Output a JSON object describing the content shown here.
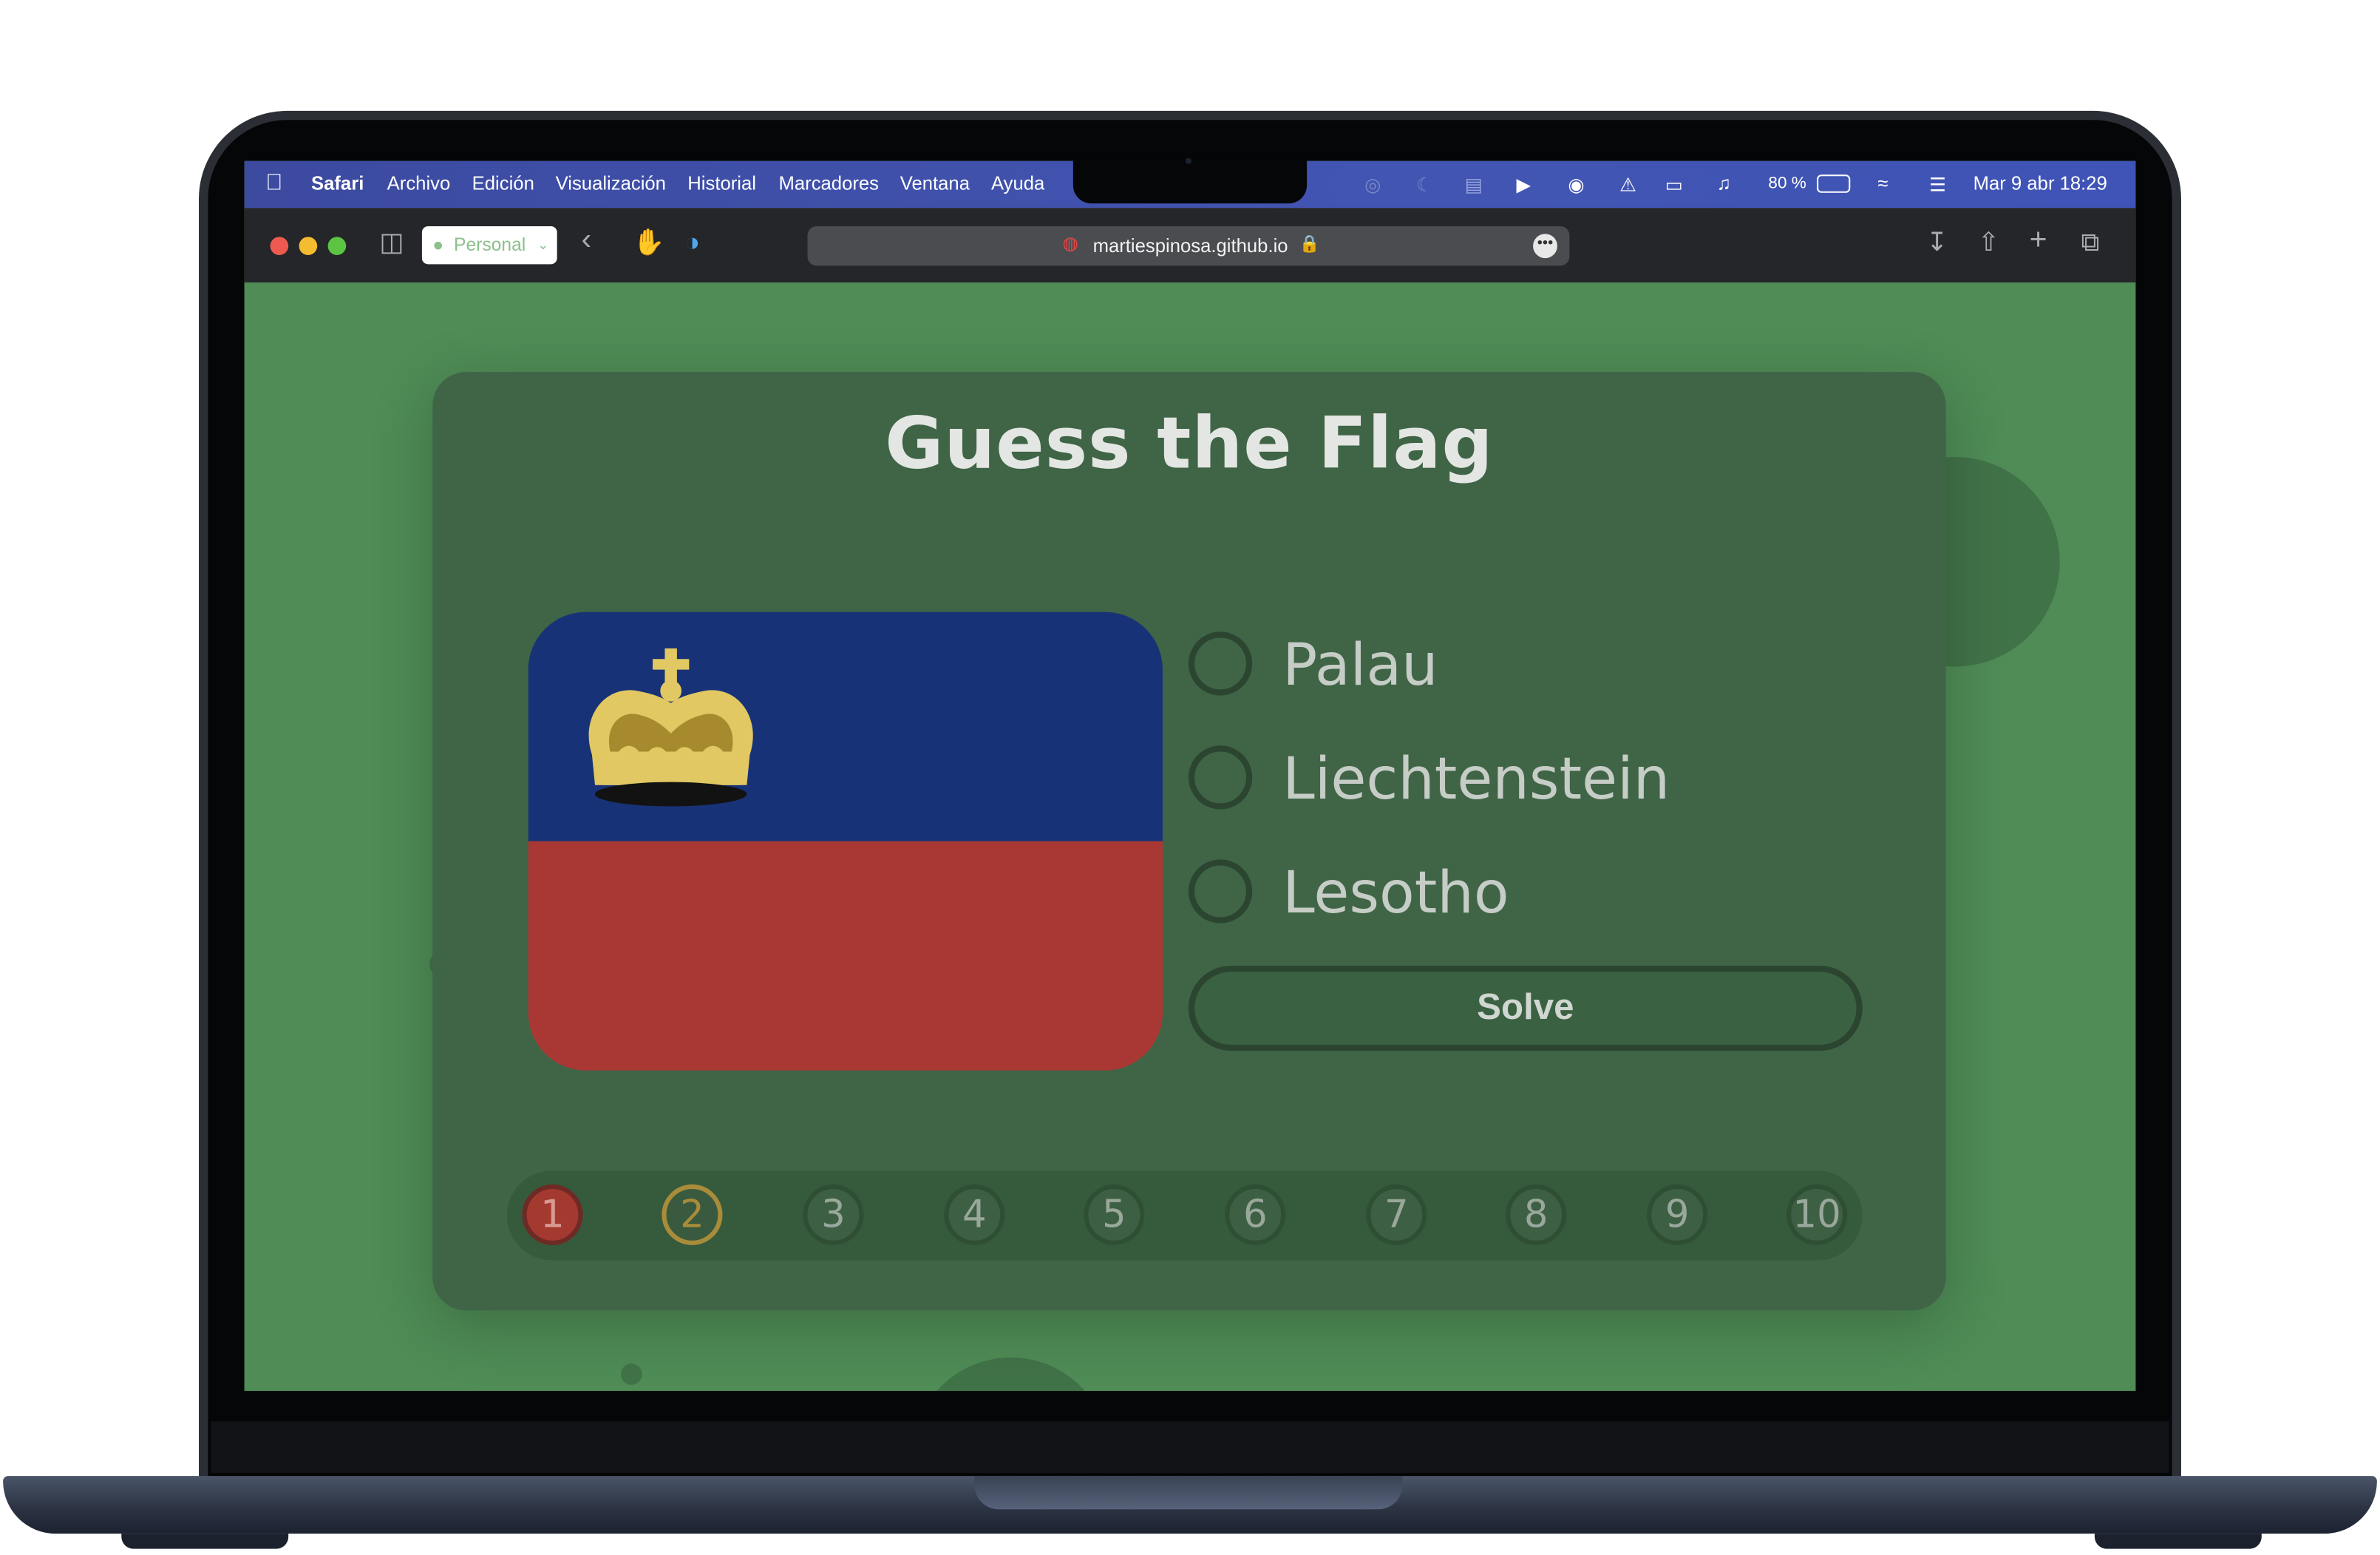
{
  "menubar": {
    "app_name": "Safari",
    "menus": [
      "Archivo",
      "Edición",
      "Visualización",
      "Historial",
      "Marcadores",
      "Ventana",
      "Ayuda"
    ],
    "battery": "80 %",
    "datetime": "Mar 9 abr 18:29"
  },
  "toolbar": {
    "profile_label": "Personal",
    "url": "martiespinosa.github.io"
  },
  "game": {
    "title": "Guess the Flag",
    "flag_country": "Liechtenstein",
    "options": [
      "Palau",
      "Liechtenstein",
      "Lesotho"
    ],
    "solve_label": "Solve",
    "progress": [
      "1",
      "2",
      "3",
      "4",
      "5",
      "6",
      "7",
      "8",
      "9",
      "10"
    ],
    "progress_states": [
      "wrong",
      "current",
      "pending",
      "pending",
      "pending",
      "pending",
      "pending",
      "pending",
      "pending",
      "pending"
    ]
  },
  "colors": {
    "page_background": "#4f8c56",
    "card_background": "#3f6546",
    "flag_blue": "#183277",
    "flag_red": "#a93834",
    "crown_gold": "#e1c863",
    "wrong": "#a4392f",
    "current": "#a98c3a"
  }
}
